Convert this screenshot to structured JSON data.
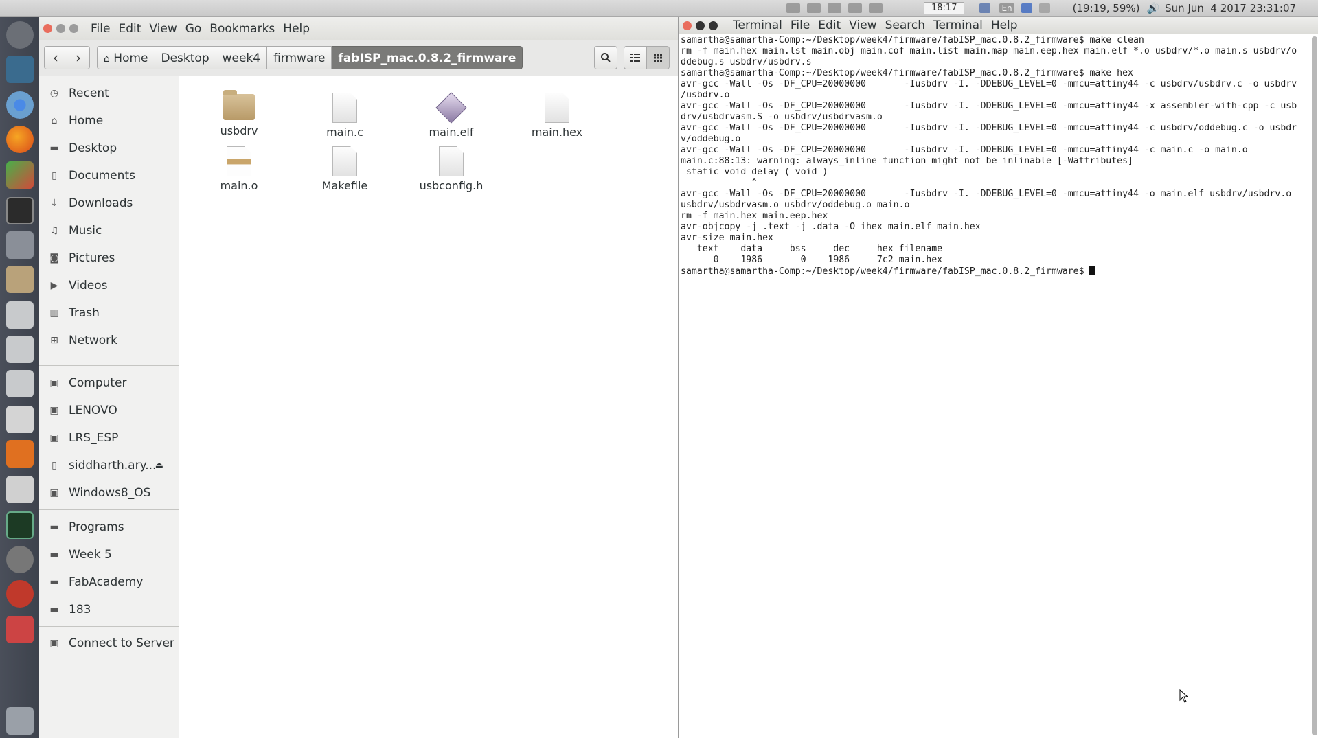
{
  "top_panel": {
    "clock_box": "18:17",
    "keyboard": "En",
    "battery": "(19:19, 59%)",
    "datetime": "Sun Jun  4 2017 23:31:07"
  },
  "launcher": {
    "icons": [
      "ubuntu-home-icon",
      "workspace-icon",
      "chrome-icon",
      "firefox-icon",
      "paint-icon",
      "terminal-icon",
      "usb-drive-icon",
      "files-icon",
      "drive-icon",
      "drive-icon",
      "drive-icon",
      "phone-icon",
      "printer-icon",
      "system-monitor-icon",
      "camera-icon",
      "app-icon",
      "scanner-icon",
      "trash-icon"
    ]
  },
  "files": {
    "menu": [
      "File",
      "Edit",
      "View",
      "Go",
      "Bookmarks",
      "Help"
    ],
    "back_icon": "chevron-left-icon",
    "forward_icon": "chevron-right-icon",
    "breadcrumbs": [
      "Home",
      "Desktop",
      "week4",
      "firmware",
      "fabISP_mac.0.8.2_firmware"
    ],
    "sidebar_groups": [
      [
        {
          "label": "Recent",
          "icon": "clock-icon"
        },
        {
          "label": "Home",
          "icon": "home-icon"
        },
        {
          "label": "Desktop",
          "icon": "folder-icon"
        },
        {
          "label": "Documents",
          "icon": "document-icon"
        },
        {
          "label": "Downloads",
          "icon": "download-icon"
        },
        {
          "label": "Music",
          "icon": "music-icon"
        },
        {
          "label": "Pictures",
          "icon": "camera-icon"
        },
        {
          "label": "Videos",
          "icon": "video-icon"
        },
        {
          "label": "Trash",
          "icon": "trash-icon"
        },
        {
          "label": "Network",
          "icon": "network-icon"
        }
      ],
      [
        {
          "label": "Computer",
          "icon": "drive-icon"
        },
        {
          "label": "LENOVO",
          "icon": "drive-icon"
        },
        {
          "label": "LRS_ESP",
          "icon": "drive-icon"
        },
        {
          "label": "siddharth.ary...",
          "icon": "phone-icon"
        },
        {
          "label": "Windows8_OS",
          "icon": "drive-icon"
        }
      ],
      [
        {
          "label": "Programs",
          "icon": "folder-icon"
        },
        {
          "label": "Week 5",
          "icon": "folder-icon"
        },
        {
          "label": "FabAcademy",
          "icon": "folder-icon"
        },
        {
          "label": "183",
          "icon": "folder-icon"
        }
      ],
      [
        {
          "label": "Connect to Server",
          "icon": "server-icon"
        }
      ]
    ],
    "files": [
      {
        "name": "usbdrv",
        "kind": "folder"
      },
      {
        "name": "main.c",
        "kind": "text"
      },
      {
        "name": "main.elf",
        "kind": "binary"
      },
      {
        "name": "main.hex",
        "kind": "text"
      },
      {
        "name": "main.o",
        "kind": "object"
      },
      {
        "name": "Makefile",
        "kind": "text"
      },
      {
        "name": "usbconfig.h",
        "kind": "text"
      }
    ]
  },
  "terminal": {
    "menu": [
      "Terminal",
      "File",
      "Edit",
      "View",
      "Search",
      "Terminal",
      "Help"
    ],
    "output": "samartha@samartha-Comp:~/Desktop/week4/firmware/fabISP_mac.0.8.2_firmware$ make clean\nrm -f main.hex main.lst main.obj main.cof main.list main.map main.eep.hex main.elf *.o usbdrv/*.o main.s usbdrv/o\nddebug.s usbdrv/usbdrv.s\nsamartha@samartha-Comp:~/Desktop/week4/firmware/fabISP_mac.0.8.2_firmware$ make hex\navr-gcc -Wall -Os -DF_CPU=20000000       -Iusbdrv -I. -DDEBUG_LEVEL=0 -mmcu=attiny44 -c usbdrv/usbdrv.c -o usbdrv\n/usbdrv.o\navr-gcc -Wall -Os -DF_CPU=20000000       -Iusbdrv -I. -DDEBUG_LEVEL=0 -mmcu=attiny44 -x assembler-with-cpp -c usb\ndrv/usbdrvasm.S -o usbdrv/usbdrvasm.o\navr-gcc -Wall -Os -DF_CPU=20000000       -Iusbdrv -I. -DDEBUG_LEVEL=0 -mmcu=attiny44 -c usbdrv/oddebug.c -o usbdr\nv/oddebug.o\navr-gcc -Wall -Os -DF_CPU=20000000       -Iusbdrv -I. -DDEBUG_LEVEL=0 -mmcu=attiny44 -c main.c -o main.o\nmain.c:88:13: warning: always_inline function might not be inlinable [-Wattributes]\n static void delay ( void )\n             ^\navr-gcc -Wall -Os -DF_CPU=20000000       -Iusbdrv -I. -DDEBUG_LEVEL=0 -mmcu=attiny44 -o main.elf usbdrv/usbdrv.o\nusbdrv/usbdrvasm.o usbdrv/oddebug.o main.o\nrm -f main.hex main.eep.hex\navr-objcopy -j .text -j .data -O ihex main.elf main.hex\navr-size main.hex\n   text    data     bss     dec     hex filename\n      0    1986       0    1986     7c2 main.hex\n",
    "prompt": "samartha@samartha-Comp:~/Desktop/week4/firmware/fabISP_mac.0.8.2_firmware$ "
  }
}
